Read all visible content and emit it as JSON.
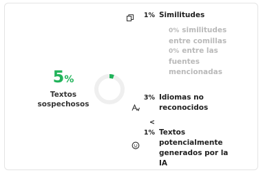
{
  "summary": {
    "percent": "5",
    "percent_unit": "%",
    "label_line1": "Textos",
    "label_line2": "sospechosos"
  },
  "donut": {
    "fraction": 0.05,
    "track_color": "#efefef",
    "fill_color": "#21b35a"
  },
  "similitudes": {
    "value": "1%",
    "label": "Similitudes"
  },
  "entre_comillas": {
    "value": "0%",
    "line1": "similitudes",
    "line2": "entre comillas"
  },
  "fuentes": {
    "value": "0%",
    "line1": "entre las",
    "line2": "fuentes",
    "line3": "mencionadas"
  },
  "idiomas": {
    "value": "3%",
    "line1": "Idiomas no",
    "line2": "reconocidos"
  },
  "ia": {
    "value": "< 1%",
    "line1": "Textos",
    "line2": "potencialmente",
    "line3": "generados por la",
    "line4": "IA"
  },
  "icons": {
    "similitudes": "copy-pages-icon",
    "idiomas": "translate-icon",
    "ia": "robot-face-icon"
  },
  "colors": {
    "accent": "#21b35a",
    "muted": "#b9b9b9",
    "text": "#1f1f1f"
  }
}
